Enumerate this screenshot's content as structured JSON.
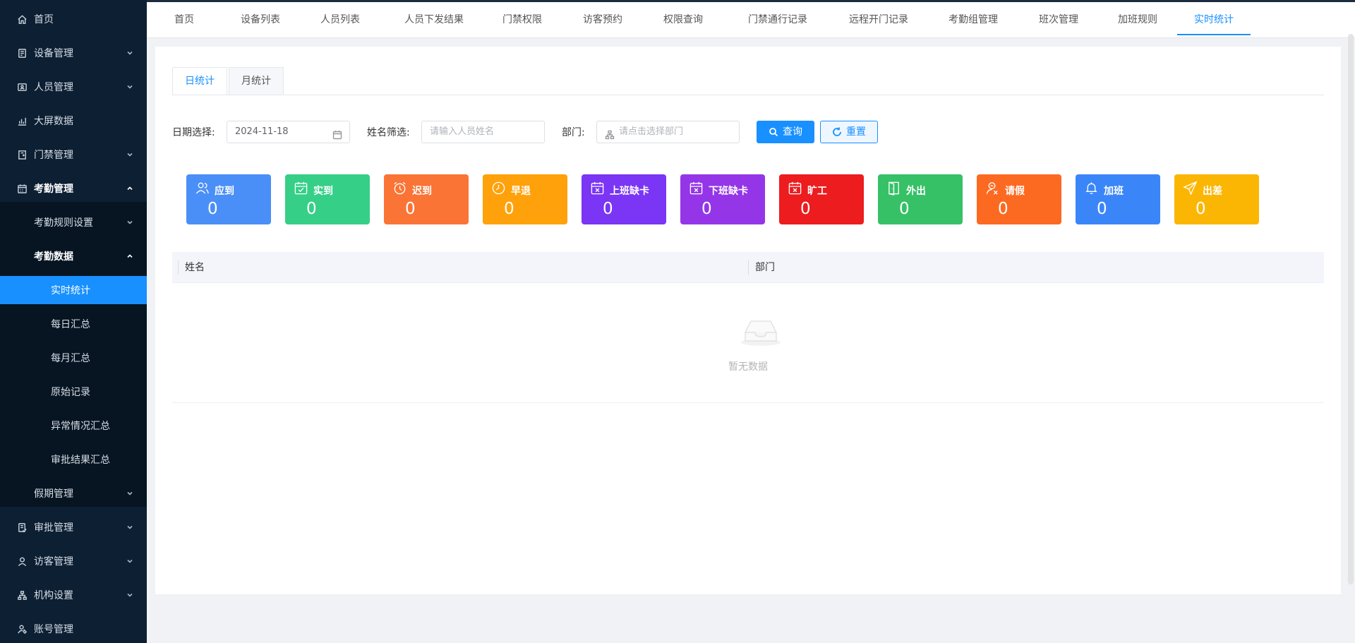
{
  "sidebar": {
    "items": [
      {
        "label": "首页",
        "icon": "home-icon",
        "arrow": "none"
      },
      {
        "label": "设备管理",
        "icon": "device-icon",
        "arrow": "down"
      },
      {
        "label": "人员管理",
        "icon": "person-card-icon",
        "arrow": "down"
      },
      {
        "label": "大屏数据",
        "icon": "chart-icon",
        "arrow": "none"
      },
      {
        "label": "门禁管理",
        "icon": "door-icon",
        "arrow": "down"
      },
      {
        "label": "考勤管理",
        "icon": "attendance-icon",
        "arrow": "up"
      },
      {
        "label": "考勤规则设置",
        "arrow": "down"
      },
      {
        "label": "考勤数据",
        "arrow": "up"
      },
      {
        "label": "实时统计"
      },
      {
        "label": "每日汇总"
      },
      {
        "label": "每月汇总"
      },
      {
        "label": "原始记录"
      },
      {
        "label": "异常情况汇总"
      },
      {
        "label": "审批结果汇总"
      },
      {
        "label": "假期管理",
        "arrow": "down"
      },
      {
        "label": "审批管理",
        "icon": "approval-icon",
        "arrow": "down"
      },
      {
        "label": "访客管理",
        "icon": "visitor-icon",
        "arrow": "down"
      },
      {
        "label": "机构设置",
        "icon": "org-icon",
        "arrow": "down"
      },
      {
        "label": "账号管理",
        "icon": "account-icon",
        "arrow": "none"
      }
    ]
  },
  "topnav": {
    "tabs": [
      "首页",
      "设备列表",
      "人员列表",
      "人员下发结果",
      "门禁权限",
      "访客预约",
      "权限查询",
      "门禁通行记录",
      "远程开门记录",
      "考勤组管理",
      "班次管理",
      "加班规则",
      "实时统计"
    ],
    "active": "实时统计"
  },
  "inner_tabs": [
    "日统计",
    "月统计"
  ],
  "filters": {
    "date_label": "日期选择:",
    "date_value": "2024-11-18",
    "name_label": "姓名筛选:",
    "name_placeholder": "请输入人员姓名",
    "dept_label": "部门:",
    "dept_placeholder": "请点击选择部门",
    "search_label": "查询",
    "reset_label": "重置"
  },
  "stats": [
    {
      "label": "应到",
      "value": "0",
      "color": "#4a8ff7",
      "icon": "people-icon"
    },
    {
      "label": "实到",
      "value": "0",
      "color": "#36cf88",
      "icon": "calendar-check-icon"
    },
    {
      "label": "迟到",
      "value": "0",
      "color": "#fa7436",
      "icon": "alarm-clock-icon"
    },
    {
      "label": "早退",
      "value": "0",
      "color": "#ffa10a",
      "icon": "clock-icon"
    },
    {
      "label": "上班缺卡",
      "value": "0",
      "color": "#7a35f5",
      "icon": "calendar-x-icon"
    },
    {
      "label": "下班缺卡",
      "value": "0",
      "color": "#9436e8",
      "icon": "calendar-x-icon"
    },
    {
      "label": "旷工",
      "value": "0",
      "color": "#ec1c1f",
      "icon": "calendar-x-icon"
    },
    {
      "label": "外出",
      "value": "0",
      "color": "#36c167",
      "icon": "door-out-icon"
    },
    {
      "label": "请假",
      "value": "0",
      "color": "#fc6a22",
      "icon": "person-leave-icon"
    },
    {
      "label": "加班",
      "value": "0",
      "color": "#3a86f9",
      "icon": "bell-icon"
    },
    {
      "label": "出差",
      "value": "0",
      "color": "#fbb604",
      "icon": "send-icon"
    }
  ],
  "table": {
    "columns": [
      "姓名",
      "部门"
    ],
    "empty_text": "暂无数据"
  }
}
